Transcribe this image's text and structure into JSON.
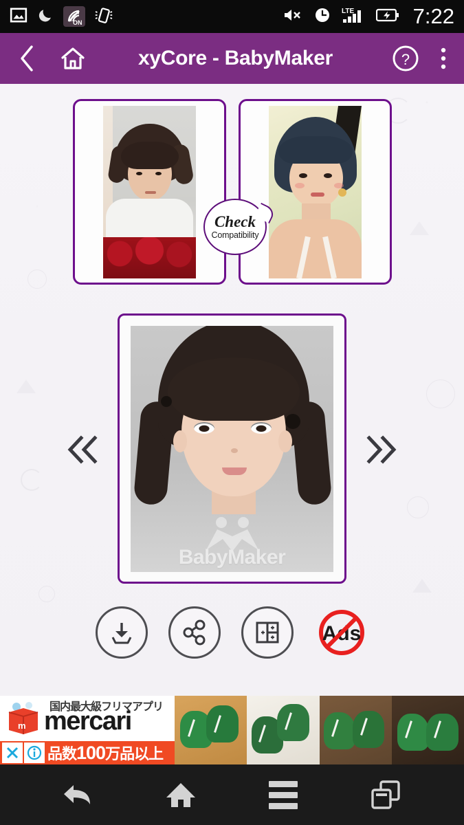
{
  "status_bar": {
    "time": "7:22",
    "left_icons": [
      {
        "name": "photo-icon",
        "label": "photo"
      },
      {
        "name": "moon-icon",
        "label": "do-not-disturb"
      },
      {
        "name": "call-on-icon",
        "label": "ON"
      },
      {
        "name": "vibrate-icon",
        "label": "vibrate"
      }
    ],
    "right_icons": [
      {
        "name": "mute-icon",
        "label": "muted"
      },
      {
        "name": "alarm-icon",
        "label": "alarm"
      },
      {
        "name": "lte-signal-icon",
        "label": "LTE"
      },
      {
        "name": "battery-charging-icon",
        "label": "charging"
      }
    ],
    "network_label": "LTE",
    "background": "#0b0b0b"
  },
  "app_bar": {
    "title": "xyCore - BabyMaker",
    "back_label": "Back",
    "home_label": "Home",
    "help_label": "Help",
    "overflow_label": "More options",
    "background": "#7b2d82",
    "text_color": "#ffffff"
  },
  "parents": {
    "father": {
      "label": "Father photo",
      "alt": "Man with dark hair in white shirt holding red roses"
    },
    "mother": {
      "label": "Mother photo",
      "alt": "Woman with short dark hair smiling outdoors"
    },
    "compatibility_badge": {
      "line1": "Check",
      "line2": "Compatibility",
      "border_color": "#5d0e7a"
    },
    "card_border_color": "#6d0f8c"
  },
  "result": {
    "alt": "Generated baby girl with pigtails and floral dress",
    "watermark_text": "BabyMaker",
    "frame_border_color": "#6d0f8c",
    "prev_label": "Previous result",
    "next_label": "Next result"
  },
  "actions": [
    {
      "name": "download-button",
      "label": "Save"
    },
    {
      "name": "share-button",
      "label": "Share"
    },
    {
      "name": "collage-button",
      "label": "Collage"
    },
    {
      "name": "no-ads-button",
      "label": "Ads",
      "color": "#e8201f"
    }
  ],
  "ad": {
    "headline_jp": "国内最大級フリマアプリ",
    "brand": "mercari",
    "footer_jp_prefix": "品数",
    "footer_jp_number": "100",
    "footer_jp_suffix": "万品以上",
    "close_label": "×",
    "info_label": "i",
    "accent": "#f04a23",
    "products_alt": "Green sneakers"
  },
  "system_nav": [
    {
      "name": "nav-back-button",
      "label": "Back"
    },
    {
      "name": "nav-home-button",
      "label": "Home"
    },
    {
      "name": "nav-menu-button",
      "label": "Menu"
    },
    {
      "name": "nav-recents-button",
      "label": "Recent apps"
    }
  ]
}
